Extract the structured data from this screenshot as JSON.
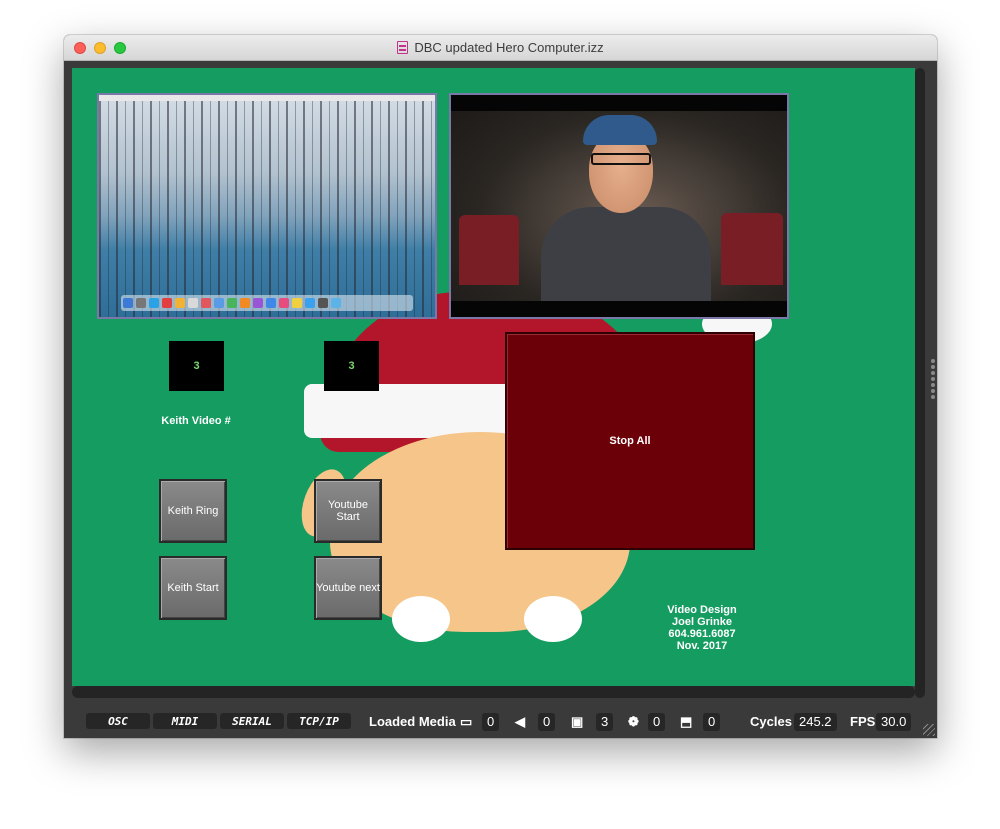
{
  "window": {
    "title": "DBC updated Hero Computer.izz"
  },
  "stage": {
    "keith_count": "3",
    "youtube_count": "3",
    "keith_video_label": "Keith Video #",
    "buttons": {
      "keith_ring": "Keith Ring",
      "keith_start": "Keith Start",
      "youtube_start": "Youtube Start",
      "youtube_next": "Youtube next",
      "stop_all": "Stop All"
    },
    "credits": [
      "Video Design",
      "Joel Grinke",
      "604.961.6087",
      "Nov. 2017"
    ]
  },
  "statusbar": {
    "tabs": [
      "OSC",
      "MIDI",
      "SERIAL",
      "TCP/IP"
    ],
    "loaded_media_label": "Loaded Media",
    "movie_count": "0",
    "sound_count": "0",
    "picture_count": "3",
    "font_count": "0",
    "object_count": "0",
    "cycles_label": "Cycles",
    "cycles_value": "245.2",
    "fps_label": "FPS",
    "fps_value": "30.0"
  },
  "icons": {
    "movie": "film-icon",
    "sound": "speaker-icon",
    "picture": "picture-icon",
    "font": "palette-icon",
    "object": "cube-icon"
  }
}
